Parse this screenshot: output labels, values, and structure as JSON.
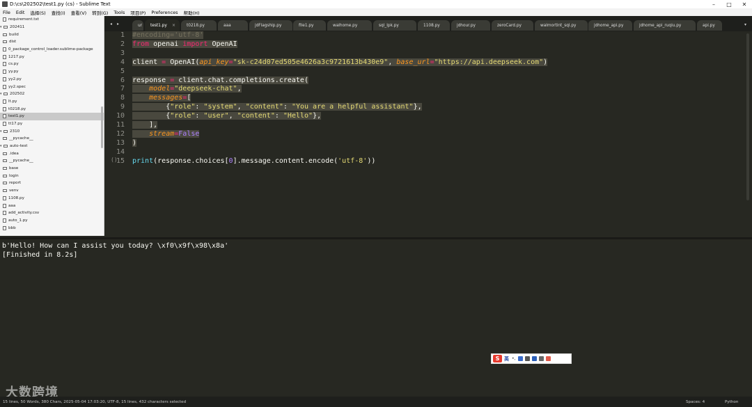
{
  "window": {
    "title": "D:\\cs\\202502\\test1.py (cs) - Sublime Text",
    "min_glyph": "–",
    "max_glyph": "□",
    "close_glyph": "✕"
  },
  "menu": [
    "File",
    "Edit",
    "选择(S)",
    "查找(I)",
    "查看(V)",
    "转到(G)",
    "Tools",
    "项目(P)",
    "Preferences",
    "帮助(H)"
  ],
  "sidebar": {
    "items": [
      {
        "label": "requirement.txt",
        "kind": "file",
        "indent": 1
      },
      {
        "label": "202411",
        "kind": "folder-open",
        "indent": 0
      },
      {
        "label": "build",
        "kind": "folder",
        "indent": 1
      },
      {
        "label": "dist",
        "kind": "folder",
        "indent": 1
      },
      {
        "label": "0_package_control_loader.sublime-package",
        "kind": "file",
        "indent": 1
      },
      {
        "label": "1217.py",
        "kind": "file",
        "indent": 1
      },
      {
        "label": "cs.py",
        "kind": "file",
        "indent": 1
      },
      {
        "label": "yy.py",
        "kind": "file",
        "indent": 1
      },
      {
        "label": "yy2.py",
        "kind": "file",
        "indent": 1
      },
      {
        "label": "yy2.spec",
        "kind": "file",
        "indent": 1
      },
      {
        "label": "202502",
        "kind": "folder-open",
        "indent": 0
      },
      {
        "label": "lt.py",
        "kind": "file",
        "indent": 1
      },
      {
        "label": "t0218.py",
        "kind": "file",
        "indent": 1
      },
      {
        "label": "test1.py",
        "kind": "file",
        "indent": 1,
        "selected": true
      },
      {
        "label": "tt17.py",
        "kind": "file",
        "indent": 1
      },
      {
        "label": "2310",
        "kind": "folder-open",
        "indent": 0
      },
      {
        "label": "__pycache__",
        "kind": "folder",
        "indent": 1
      },
      {
        "label": "auto-test",
        "kind": "folder-open",
        "indent": 0
      },
      {
        "label": ".idea",
        "kind": "folder",
        "indent": 1
      },
      {
        "label": "__pycache__",
        "kind": "folder",
        "indent": 1
      },
      {
        "label": "base",
        "kind": "folder",
        "indent": 1
      },
      {
        "label": "login",
        "kind": "folder",
        "indent": 1
      },
      {
        "label": "report",
        "kind": "folder",
        "indent": 1
      },
      {
        "label": "venv",
        "kind": "folder",
        "indent": 1
      },
      {
        "label": "1108.py",
        "kind": "file",
        "indent": 1
      },
      {
        "label": "aaa",
        "kind": "file",
        "indent": 1
      },
      {
        "label": "add_activity.csv",
        "kind": "file",
        "indent": 1
      },
      {
        "label": "auto_1.py",
        "kind": "file",
        "indent": 1
      },
      {
        "label": "bbb",
        "kind": "file",
        "indent": 1
      }
    ]
  },
  "tabs": {
    "prev": "◂",
    "next": "▸",
    "menu": "▾",
    "items": [
      {
        "label": "ur",
        "active": false
      },
      {
        "label": "test1.py",
        "active": true
      },
      {
        "label": "t0218.py",
        "active": false
      },
      {
        "label": "aaa",
        "active": false
      },
      {
        "label": "jdFlagship.py",
        "active": false
      },
      {
        "label": "file1.py",
        "active": false
      },
      {
        "label": "walhome.py",
        "active": false
      },
      {
        "label": "sql_lpk.py",
        "active": false
      },
      {
        "label": "1108.py",
        "active": false
      },
      {
        "label": "jdhour.py",
        "active": false
      },
      {
        "label": "zeroCard.py",
        "active": false
      },
      {
        "label": "walmortint_sql.py",
        "active": false
      },
      {
        "label": "jdhome_api.py",
        "active": false
      },
      {
        "label": "jdhome_api_ruqiu.py",
        "active": false
      },
      {
        "label": "api.py",
        "active": false
      }
    ]
  },
  "editor": {
    "line_numbers": [
      "1",
      "2",
      "3",
      "4",
      "5",
      "6",
      "7",
      "8",
      "9",
      "10",
      "11",
      "12",
      "13",
      "14",
      "15"
    ],
    "fold_marker": "()",
    "lines": [
      "#encoding='utf-8'",
      "from openai import OpenAI",
      "",
      "client = OpenAI(api_key=\"sk-c24d07ed505e4626a3c9721613b430e9\", base_url=\"https://api.deepseek.com\")",
      "",
      "response = client.chat.completions.create(",
      "    model=\"deepseek-chat\",",
      "    messages=[",
      "        {\"role\": \"system\", \"content\": \"You are a helpful assistant\"},",
      "        {\"role\": \"user\", \"content\": \"Hello\"},",
      "    ],",
      "    stream=False",
      ")",
      "",
      "print(response.choices[0].message.content.encode('utf-8'))"
    ]
  },
  "output": {
    "lines": [
      "b'Hello! How can I assist you today? \\xf0\\x9f\\x98\\x8a'",
      "[Finished in 8.2s]"
    ]
  },
  "ime": {
    "logo": "S",
    "lang": "英",
    "punct": "•,"
  },
  "watermark": "大数跨境",
  "status": {
    "left": "15 lines, 50 Words, 380 Chars, 2025-05-04 17:03:20, UTF-8, 15 lines, 432 characters selected",
    "spaces": "Spaces: 4",
    "syntax": "Python"
  }
}
